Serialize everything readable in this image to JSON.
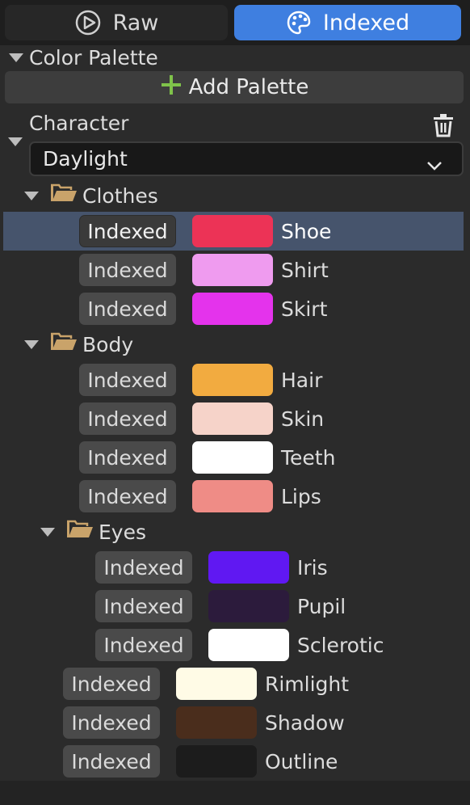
{
  "tabs": {
    "raw": {
      "label": "Raw",
      "icon": "play-circle-icon"
    },
    "indexed": {
      "label": "Indexed",
      "icon": "palette-icon",
      "active": true
    }
  },
  "panel": {
    "title": "Color Palette"
  },
  "add_palette": {
    "label": "Add Palette",
    "icon_color": "#7fc24a"
  },
  "character": {
    "label": "Character",
    "selected": "Daylight"
  },
  "colors": {
    "accent": "#3f7fe0",
    "selection": "#46546c",
    "folder": "#c9a36a"
  },
  "folders": {
    "clothes": {
      "label": "Clothes",
      "items": [
        {
          "mode": "Indexed",
          "color": "#ec3356",
          "label": "Shoe",
          "selected": true
        },
        {
          "mode": "Indexed",
          "color": "#ef9bef",
          "label": "Shirt"
        },
        {
          "mode": "Indexed",
          "color": "#e433ec",
          "label": "Skirt"
        }
      ]
    },
    "body": {
      "label": "Body",
      "items": [
        {
          "mode": "Indexed",
          "color": "#f2ab40",
          "label": "Hair"
        },
        {
          "mode": "Indexed",
          "color": "#f6d3c9",
          "label": "Skin"
        },
        {
          "mode": "Indexed",
          "color": "#ffffff",
          "label": "Teeth"
        },
        {
          "mode": "Indexed",
          "color": "#ef8c86",
          "label": "Lips"
        }
      ]
    },
    "eyes": {
      "label": "Eyes",
      "items": [
        {
          "mode": "Indexed",
          "color": "#6018f2",
          "label": "Iris"
        },
        {
          "mode": "Indexed",
          "color": "#2c1b3c",
          "label": "Pupil"
        },
        {
          "mode": "Indexed",
          "color": "#ffffff",
          "label": "Sclerotic"
        }
      ]
    },
    "body_extra": [
      {
        "mode": "Indexed",
        "color": "#fffbe6",
        "label": "Rimlight"
      },
      {
        "mode": "Indexed",
        "color": "#4a2d1c",
        "label": "Shadow"
      },
      {
        "mode": "Indexed",
        "color": "#1c1c1c",
        "label": "Outline"
      }
    ]
  }
}
